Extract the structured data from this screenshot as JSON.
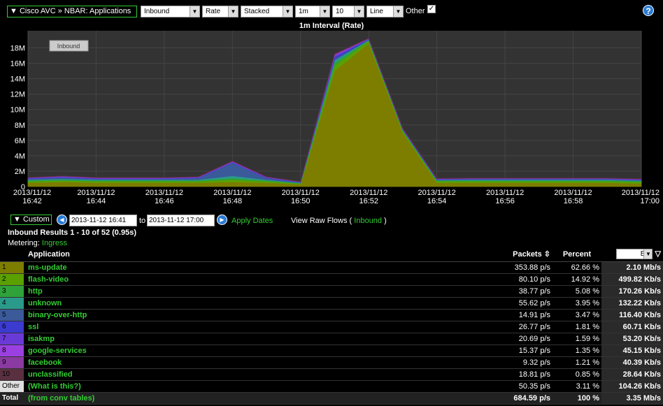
{
  "toolbar": {
    "title": "▼ Cisco AVC » NBAR: Applications",
    "direction": "Inbound",
    "measure": "Rate",
    "mode": "Stacked",
    "interval": "1m",
    "top_n": "10",
    "chart_type": "Line",
    "other_label": "Other",
    "other_checked": "✓",
    "help": "?"
  },
  "chart_title": "1m Interval (Rate)",
  "chart_data": {
    "type": "area",
    "title": "1m Interval (Rate)",
    "legend_button": "Inbound",
    "y_ticks": [
      "0",
      "2M",
      "4M",
      "6M",
      "8M",
      "10M",
      "12M",
      "14M",
      "16M",
      "18M"
    ],
    "ylim": [
      0,
      19500000
    ],
    "x_ticks": [
      [
        "2013/11/12",
        "16:42"
      ],
      [
        "2013/11/12",
        "16:44"
      ],
      [
        "2013/11/12",
        "16:46"
      ],
      [
        "2013/11/12",
        "16:48"
      ],
      [
        "2013/11/12",
        "16:50"
      ],
      [
        "2013/11/12",
        "16:52"
      ],
      [
        "2013/11/12",
        "16:54"
      ],
      [
        "2013/11/12",
        "16:56"
      ],
      [
        "2013/11/12",
        "16:58"
      ],
      [
        "2013/11/12",
        "17:00"
      ]
    ],
    "x": [
      "16:42",
      "16:43",
      "16:44",
      "16:45",
      "16:46",
      "16:47",
      "16:48",
      "16:49",
      "16:50",
      "16:51",
      "16:52",
      "16:53",
      "16:54",
      "16:55",
      "16:56",
      "16:57",
      "16:58",
      "16:59",
      "17:00"
    ],
    "series": [
      {
        "name": "ms-update",
        "color": "#7d7d00",
        "values": [
          0.5,
          0.6,
          0.5,
          0.5,
          0.5,
          0.5,
          0.6,
          0.5,
          0.3,
          15.0,
          18.6,
          7.0,
          0.5,
          0.5,
          0.5,
          0.5,
          0.5,
          0.5,
          0.4
        ]
      },
      {
        "name": "flash-video",
        "color": "#5aa000",
        "values": [
          0.2,
          0.2,
          0.2,
          0.2,
          0.2,
          0.2,
          0.3,
          0.2,
          0.1,
          0.7,
          0.3,
          0.2,
          0.2,
          0.2,
          0.2,
          0.2,
          0.2,
          0.2,
          0.2
        ]
      },
      {
        "name": "http",
        "color": "#2fa23a",
        "values": [
          0.1,
          0.1,
          0.1,
          0.1,
          0.1,
          0.1,
          0.2,
          0.1,
          0.05,
          0.4,
          0.1,
          0.1,
          0.1,
          0.1,
          0.1,
          0.1,
          0.1,
          0.1,
          0.1
        ]
      },
      {
        "name": "unknown",
        "color": "#2a9a8a",
        "values": [
          0.1,
          0.1,
          0.1,
          0.1,
          0.1,
          0.1,
          0.3,
          0.1,
          0.05,
          0.3,
          0.05,
          0.05,
          0.05,
          0.1,
          0.1,
          0.1,
          0.1,
          0.1,
          0.1
        ]
      },
      {
        "name": "binary-over-http",
        "color": "#3a5a9a",
        "values": [
          0.1,
          0.2,
          0.1,
          0.1,
          0.1,
          0.2,
          1.7,
          0.2,
          0.05,
          0.2,
          0.05,
          0.05,
          0.05,
          0.05,
          0.05,
          0.05,
          0.05,
          0.05,
          0.05
        ]
      },
      {
        "name": "ssl",
        "color": "#3b3bd0",
        "values": [
          0.05,
          0.05,
          0.05,
          0.05,
          0.05,
          0.05,
          0.05,
          0.05,
          0.02,
          0.2,
          0.05,
          0.05,
          0.05,
          0.05,
          0.05,
          0.05,
          0.05,
          0.05,
          0.05
        ]
      },
      {
        "name": "isakmp",
        "color": "#6a3ad6",
        "values": [
          0.05,
          0.05,
          0.05,
          0.05,
          0.05,
          0.05,
          0.05,
          0.05,
          0.02,
          0.2,
          0.03,
          0.03,
          0.03,
          0.03,
          0.03,
          0.03,
          0.03,
          0.03,
          0.03
        ]
      },
      {
        "name": "google-services",
        "color": "#9a40e0",
        "values": [
          0.03,
          0.03,
          0.03,
          0.03,
          0.03,
          0.03,
          0.05,
          0.03,
          0.02,
          0.1,
          0.03,
          0.03,
          0.03,
          0.03,
          0.03,
          0.03,
          0.03,
          0.03,
          0.03
        ]
      },
      {
        "name": "facebook",
        "color": "#8a3aa0",
        "values": [
          0.03,
          0.03,
          0.03,
          0.03,
          0.03,
          0.03,
          0.05,
          0.03,
          0.02,
          0.1,
          0.03,
          0.03,
          0.03,
          0.03,
          0.03,
          0.03,
          0.03,
          0.03,
          0.03
        ]
      },
      {
        "name": "unclassified",
        "color": "#5a3040",
        "values": [
          0.02,
          0.02,
          0.02,
          0.02,
          0.02,
          0.02,
          0.02,
          0.02,
          0.01,
          0.05,
          0.02,
          0.02,
          0.02,
          0.02,
          0.02,
          0.02,
          0.02,
          0.02,
          0.02
        ]
      }
    ],
    "grid": true
  },
  "range": {
    "custom_label": "▼ Custom",
    "start": "2013-11-12 16:41",
    "to_label": "to",
    "end": "2013-11-12 17:00",
    "apply_label": "Apply Dates",
    "raw_flows_prefix": "View Raw Flows (",
    "raw_flows_link": "Inbound",
    "raw_flows_suffix": ")"
  },
  "results_text": "Inbound Results 1 - 10 of 52 (0.95s)",
  "metering_label": "Metering:",
  "metering_value": "Ingress",
  "table": {
    "headers": {
      "application": "Application",
      "packets": "Packets",
      "packets_sort": "⇳",
      "percent": "Percent",
      "unit": "Bits"
    },
    "rows": [
      {
        "idx": "1",
        "color": "#7d7d00",
        "name": "ms-update",
        "packets": "353.88 p/s",
        "percent": "62.66 %",
        "bits": "2.10 Mb/s"
      },
      {
        "idx": "2",
        "color": "#5aa000",
        "name": "flash-video",
        "packets": "80.10 p/s",
        "percent": "14.92 %",
        "bits": "499.82 Kb/s"
      },
      {
        "idx": "3",
        "color": "#2fa23a",
        "name": "http",
        "packets": "38.77 p/s",
        "percent": "5.08 %",
        "bits": "170.26 Kb/s"
      },
      {
        "idx": "4",
        "color": "#2a9a8a",
        "name": "unknown",
        "packets": "55.62 p/s",
        "percent": "3.95 %",
        "bits": "132.22 Kb/s"
      },
      {
        "idx": "5",
        "color": "#3a5a9a",
        "name": "binary-over-http",
        "packets": "14.91 p/s",
        "percent": "3.47 %",
        "bits": "116.40 Kb/s"
      },
      {
        "idx": "6",
        "color": "#3b3bd0",
        "name": "ssl",
        "packets": "26.77 p/s",
        "percent": "1.81 %",
        "bits": "60.71 Kb/s"
      },
      {
        "idx": "7",
        "color": "#6a3ad6",
        "name": "isakmp",
        "packets": "20.69 p/s",
        "percent": "1.59 %",
        "bits": "53.20 Kb/s"
      },
      {
        "idx": "8",
        "color": "#9a40e0",
        "name": "google-services",
        "packets": "15.37 p/s",
        "percent": "1.35 %",
        "bits": "45.15 Kb/s"
      },
      {
        "idx": "9",
        "color": "#8a3aa0",
        "name": "facebook",
        "packets": "9.32 p/s",
        "percent": "1.21 %",
        "bits": "40.39 Kb/s"
      },
      {
        "idx": "10",
        "color": "#5a3040",
        "name": "unclassified",
        "packets": "18.81 p/s",
        "percent": "0.85 %",
        "bits": "28.64 Kb/s"
      },
      {
        "idx": "Other",
        "color": "#e0e0e0",
        "name": "(What is this?)",
        "packets": "50.35 p/s",
        "percent": "3.11 %",
        "bits": "104.26 Kb/s"
      }
    ],
    "total": {
      "label": "Total",
      "name": "(from conv tables)",
      "packets": "684.59 p/s",
      "percent": "100 %",
      "bits": "3.35 Mb/s"
    }
  }
}
